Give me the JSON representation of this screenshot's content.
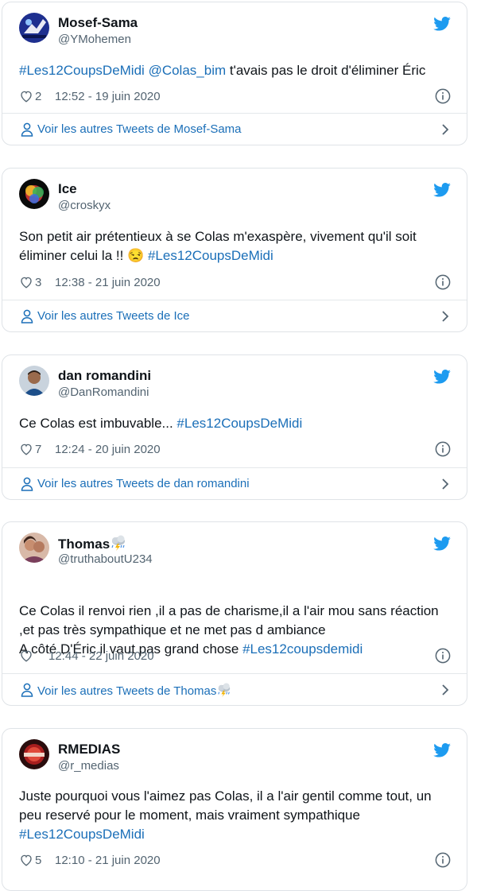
{
  "tweets": [
    {
      "name": "Mosef-Sama",
      "handle": "@YMohemen",
      "text_parts": [
        {
          "t": "#Les12CoupsDeMidi",
          "tag": true
        },
        {
          "t": " ",
          "tag": false
        },
        {
          "t": "@Colas_bim",
          "tag": true
        },
        {
          "t": "  t'avais pas le droit d'éliminer Éric",
          "tag": false
        }
      ],
      "likes": "2",
      "time": "12:52 - 19 juin 2020",
      "more": "Voir les autres Tweets de Mosef-Sama"
    },
    {
      "name": "Ice",
      "handle": "@croskyx",
      "text_parts": [
        {
          "t": "Son petit air prétentieux à se Colas m'exaspère, vivement qu'il soit éliminer celui la !! ",
          "tag": false
        },
        {
          "t": "😒",
          "tag": false
        },
        {
          "t": " ",
          "tag": false
        },
        {
          "t": "#Les12CoupsDeMidi",
          "tag": true
        }
      ],
      "likes": "3",
      "time": "12:38 - 21 juin 2020",
      "more": "Voir les autres Tweets de Ice"
    },
    {
      "name": "dan romandini",
      "handle": "@DanRomandini",
      "text_parts": [
        {
          "t": "Ce Colas est imbuvable... ",
          "tag": false
        },
        {
          "t": "#Les12CoupsDeMidi",
          "tag": true
        }
      ],
      "likes": "7",
      "time": "12:24 - 20 juin 2020",
      "more": "Voir les autres Tweets de dan romandini"
    },
    {
      "name": "Thomas",
      "handle": "@truthaboutU234",
      "name_emoji": "cloud-with-lightning-and-rain",
      "text_parts": [
        {
          "t": "Ce Colas il renvoi rien ,il a pas de charisme,il a l'air mou sans réaction ,et pas très sympathique et ne met pas d ambiance",
          "tag": false
        },
        {
          "t": "\nA côté D'Éric il vaut pas grand chose ",
          "tag": false
        },
        {
          "t": "#Les12coupsdemidi",
          "tag": true
        }
      ],
      "likes": "",
      "time": "12:44 - 22 juin 2020",
      "more": "Voir les autres Tweets de Thomas"
    },
    {
      "name": "RMEDIAS",
      "handle": "@r_medias",
      "text_parts": [
        {
          "t": "Juste pourquoi vous l'aimez pas Colas, il a l'air gentil comme tout, un peu reservé pour le moment, mais vraiment sympathique ",
          "tag": false
        },
        {
          "t": "#Les12CoupsDeMidi",
          "tag": true
        }
      ],
      "likes": "5",
      "time": "12:10 - 21 juin 2020",
      "more": ""
    }
  ],
  "icons": {
    "bird": "twitter-bird-icon",
    "heart": "heart-icon",
    "info": "info-icon",
    "person": "person-icon",
    "chevron": "chevron-right-icon"
  },
  "colors": {
    "accent": "#1b6fb8",
    "twitter_blue": "#1d9bf0",
    "muted": "#536471",
    "border": "#dfe3e7"
  }
}
